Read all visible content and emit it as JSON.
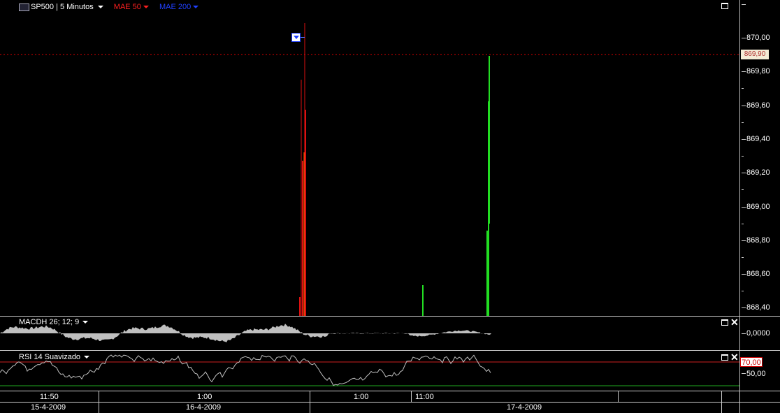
{
  "main_chart": {
    "symbol": "SP500",
    "interval": "5 Minutos",
    "indicator_1": "MAE 50",
    "indicator_2": "MAE 200",
    "current_price_tag": "869,90",
    "price_ticks": [
      "870,00",
      "869,80",
      "869,60",
      "869,40",
      "869,20",
      "869,00",
      "868,80",
      "868,60",
      "868,40"
    ],
    "colors": {
      "up": "#22dd22",
      "down": "#dd1111",
      "mae50": "#ff2020",
      "mae200": "#2040ff",
      "price_line": "#dd0000"
    }
  },
  "macd_panel": {
    "label": "MACDH 26; 12; 9",
    "tick": "0,0000"
  },
  "rsi_panel": {
    "label": "RSI 14 Suavizado",
    "upper_tag": "70,00",
    "mid_tick": "50,00"
  },
  "time_axis": {
    "times": [
      "11:50",
      "1:00",
      "1:00",
      "11:00"
    ],
    "dates": [
      "15-4-2009",
      "16-4-2009",
      "17-4-2009"
    ]
  }
}
